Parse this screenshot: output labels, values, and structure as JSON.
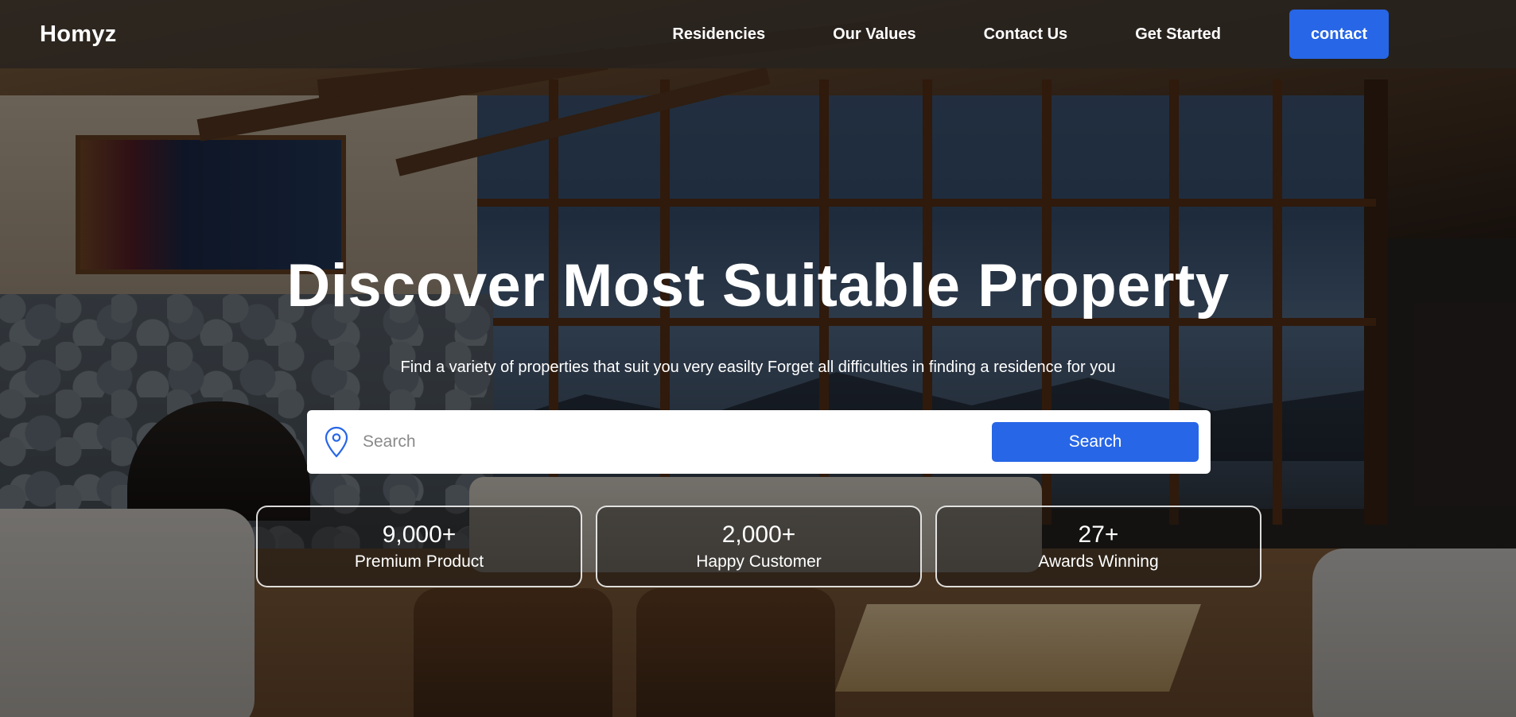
{
  "brand": {
    "logo": "Homyz"
  },
  "nav": {
    "links": [
      "Residencies",
      "Our Values",
      "Contact Us",
      "Get Started"
    ],
    "contact_button": "contact"
  },
  "hero": {
    "title": "Discover Most Suitable Property",
    "subtitle": "Find a variety of properties that suit you very easilty Forget all difficulties in finding a residence for you"
  },
  "search": {
    "placeholder": "Search",
    "button_label": "Search",
    "icon": "map-pin-icon"
  },
  "stats": [
    {
      "value": "9,000+",
      "label": "Premium Product"
    },
    {
      "value": "2,000+",
      "label": "Happy Customer"
    },
    {
      "value": "27+",
      "label": "Awards Winning"
    }
  ],
  "colors": {
    "accent": "#2766e6",
    "header_bg": "#26221f",
    "text": "#ffffff"
  }
}
